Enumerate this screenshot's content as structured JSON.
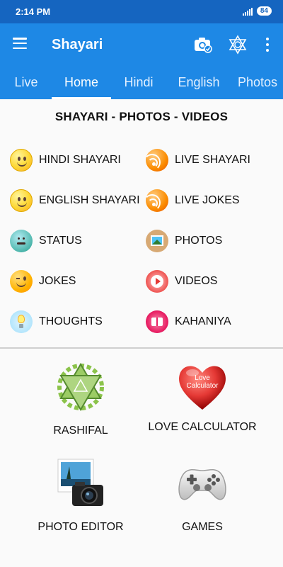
{
  "status_bar": {
    "time": "2:14 PM",
    "battery": "84"
  },
  "app_bar": {
    "title": "Shayari",
    "icons": [
      "menu-icon",
      "camera-icon",
      "star-of-david-icon",
      "more-vert-icon"
    ]
  },
  "tabs": [
    {
      "label": "Live",
      "active": false
    },
    {
      "label": "Home",
      "active": true
    },
    {
      "label": "Hindi",
      "active": false
    },
    {
      "label": "English",
      "active": false
    },
    {
      "label": "Photos",
      "active": false
    }
  ],
  "section_title": "SHAYARI - PHOTOS - VIDEOS",
  "grid": {
    "left": [
      {
        "label": "HINDI SHAYARI",
        "icon": "smiley-icon"
      },
      {
        "label": "ENGLISH SHAYARI",
        "icon": "smiley-icon"
      },
      {
        "label": "STATUS",
        "icon": "neutral-face-icon"
      },
      {
        "label": "JOKES",
        "icon": "wink-face-icon"
      },
      {
        "label": "THOUGHTS",
        "icon": "lightbulb-icon"
      }
    ],
    "right": [
      {
        "label": "LIVE SHAYARI",
        "icon": "rss-icon"
      },
      {
        "label": "LIVE JOKES",
        "icon": "rss-icon"
      },
      {
        "label": "PHOTOS",
        "icon": "photo-icon"
      },
      {
        "label": "VIDEOS",
        "icon": "play-icon"
      },
      {
        "label": "KAHANIYA",
        "icon": "book-icon"
      }
    ]
  },
  "features": [
    {
      "label": "RASHIFAL",
      "icon": "hexagram-icon"
    },
    {
      "label": "LOVE CALCULATOR",
      "icon": "heart-icon",
      "icon_text": "Love Calculator"
    },
    {
      "label": "PHOTO EDITOR",
      "icon": "camera-photo-icon"
    },
    {
      "label": "GAMES",
      "icon": "gamepad-icon"
    }
  ],
  "colors": {
    "app_bar": "#1e88e5",
    "status_bar": "#1565c0",
    "accent": "#ffffff"
  }
}
